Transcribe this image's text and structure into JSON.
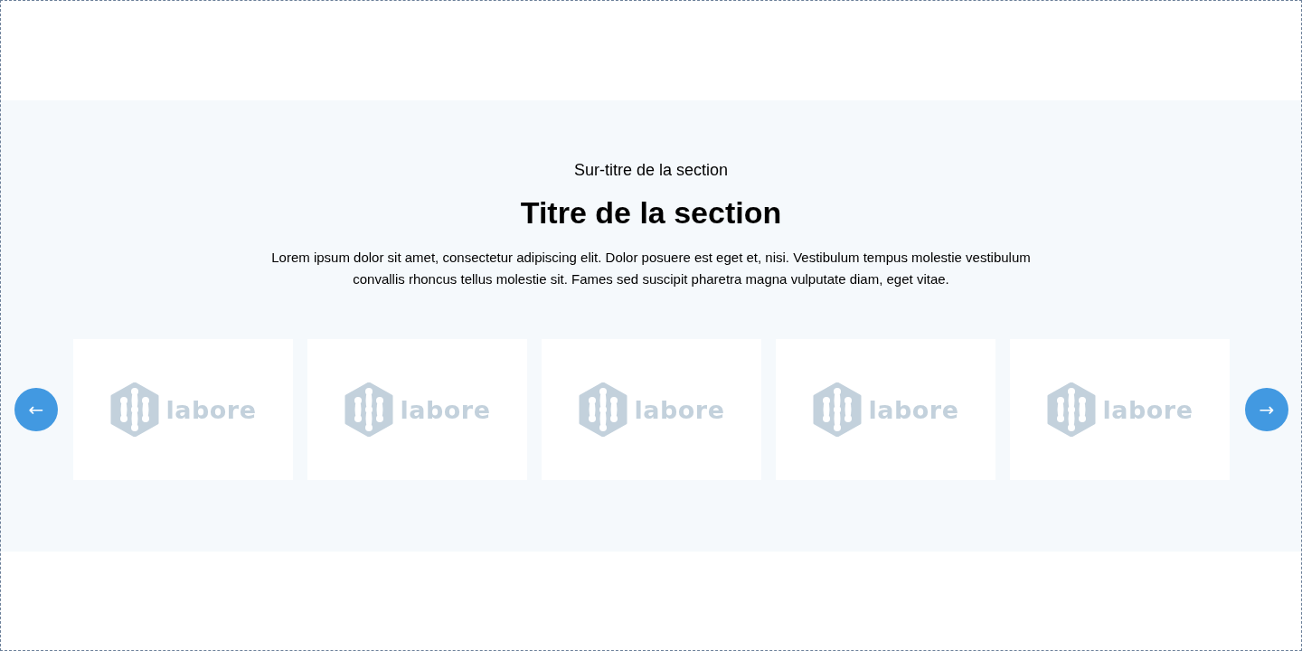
{
  "section": {
    "overtitle": "Sur-titre de la section",
    "title": "Titre de la section",
    "description": "Lorem ipsum dolor sit amet, consectetur adipiscing elit. Dolor posuere est eget et, nisi. Vestibulum tempus molestie vestibulum convallis rhoncus tellus molestie sit. Fames sed suscipit pharetra magna vulputate diam, eget vitae."
  },
  "carousel": {
    "previous_button": "←",
    "next_button": "→",
    "logos": [
      {
        "name": "labore"
      },
      {
        "name": "labore"
      },
      {
        "name": "labore"
      },
      {
        "name": "labore"
      },
      {
        "name": "labore"
      }
    ]
  }
}
